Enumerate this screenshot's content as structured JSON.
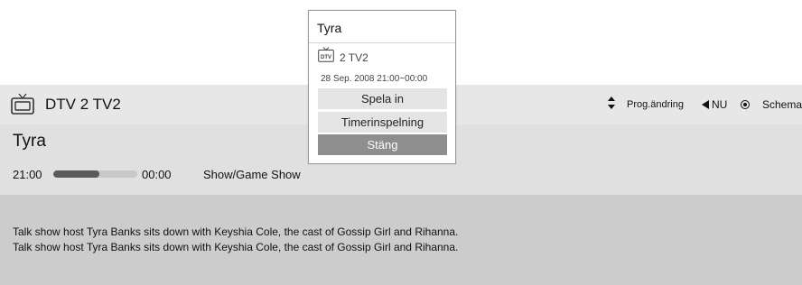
{
  "header": {
    "channel": "DTV 2  TV2",
    "prog_change_label": "Prog.ändring",
    "now_label": "NU",
    "schedule_label": "Schema"
  },
  "program": {
    "title": "Tyra",
    "start_time": "21:00",
    "end_time": "00:00",
    "progress": 0.55,
    "genre": "Show/Game Show",
    "description": [
      "Talk show host Tyra Banks sits down with Keyshia Cole, the cast of Gossip Girl and Rihanna.",
      "Talk show host Tyra Banks sits down with Keyshia Cole, the cast of Gossip Girl and Rihanna."
    ]
  },
  "popup": {
    "title": "Tyra",
    "badge": "DTV",
    "channel": "2 TV2",
    "datetime": "28 Sep. 2008 21:00~00:00",
    "buttons": [
      "Spela in",
      "Timerinspelning",
      "Stäng"
    ]
  },
  "icons": {
    "tv": "tv-icon",
    "updown": "up-down-arrows-icon",
    "left": "left-arrow-icon",
    "radio": "radio-icon"
  },
  "colors": {
    "header_bg": "#e7e7e7",
    "info_bg": "#e0e0e0",
    "desc_bg": "#cccccc",
    "selected_button": "#8e8e8e"
  }
}
